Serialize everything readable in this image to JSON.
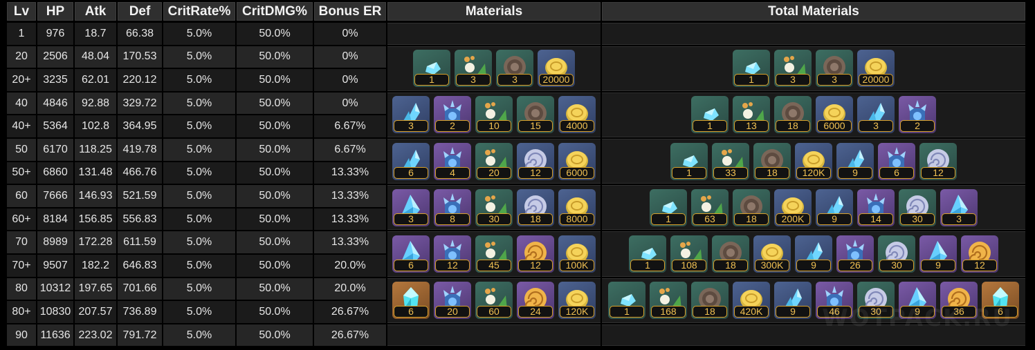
{
  "headers": {
    "lv": "Lv",
    "hp": "HP",
    "atk": "Atk",
    "def": "Def",
    "crit_rate": "CritRate%",
    "crit_dmg": "CritDMG%",
    "bonus_er": "Bonus ER",
    "materials": "Materials",
    "total_materials": "Total Materials"
  },
  "rows": [
    [
      "1",
      "976",
      "18.7",
      "66.38",
      "5.0%",
      "50.0%",
      "0%"
    ],
    [
      "20",
      "2506",
      "48.04",
      "170.53",
      "5.0%",
      "50.0%",
      "0%"
    ],
    [
      "20+",
      "3235",
      "62.01",
      "220.12",
      "5.0%",
      "50.0%",
      "0%"
    ],
    [
      "40",
      "4846",
      "92.88",
      "329.72",
      "5.0%",
      "50.0%",
      "0%"
    ],
    [
      "40+",
      "5364",
      "102.8",
      "364.95",
      "5.0%",
      "50.0%",
      "6.67%"
    ],
    [
      "50",
      "6170",
      "118.25",
      "419.78",
      "5.0%",
      "50.0%",
      "6.67%"
    ],
    [
      "50+",
      "6860",
      "131.48",
      "466.76",
      "5.0%",
      "50.0%",
      "13.33%"
    ],
    [
      "60",
      "7666",
      "146.93",
      "521.59",
      "5.0%",
      "50.0%",
      "13.33%"
    ],
    [
      "60+",
      "8184",
      "156.85",
      "556.83",
      "5.0%",
      "50.0%",
      "13.33%"
    ],
    [
      "70",
      "8989",
      "172.28",
      "611.59",
      "5.0%",
      "50.0%",
      "13.33%"
    ],
    [
      "70+",
      "9507",
      "182.2",
      "646.83",
      "5.0%",
      "50.0%",
      "20.0%"
    ],
    [
      "80",
      "10312",
      "197.65",
      "701.66",
      "5.0%",
      "50.0%",
      "20.0%"
    ],
    [
      "80+",
      "10830",
      "207.57",
      "736.89",
      "5.0%",
      "50.0%",
      "26.67%"
    ],
    [
      "90",
      "11636",
      "223.02",
      "791.72",
      "5.0%",
      "50.0%",
      "26.67%"
    ]
  ],
  "material_blocks": [
    {
      "materials": [
        {
          "icon": "gem-sliver-icon",
          "quality": "green",
          "count": "1"
        },
        {
          "icon": "local-specialty-icon",
          "quality": "green",
          "count": "3"
        },
        {
          "icon": "shell-drop-icon",
          "quality": "green",
          "count": "3"
        },
        {
          "icon": "mora-coin-icon",
          "quality": "blue",
          "count": "20000"
        }
      ],
      "totals": [
        {
          "icon": "gem-sliver-icon",
          "quality": "green",
          "count": "1"
        },
        {
          "icon": "local-specialty-icon",
          "quality": "green",
          "count": "3"
        },
        {
          "icon": "shell-drop-icon",
          "quality": "green",
          "count": "3"
        },
        {
          "icon": "mora-coin-icon",
          "quality": "blue",
          "count": "20000"
        }
      ]
    },
    {
      "materials": [
        {
          "icon": "gem-fragment-icon",
          "quality": "blue",
          "count": "3"
        },
        {
          "icon": "boss-crystal-icon",
          "quality": "purple",
          "count": "2"
        },
        {
          "icon": "local-specialty-icon",
          "quality": "green",
          "count": "10"
        },
        {
          "icon": "shell-drop-icon",
          "quality": "green",
          "count": "15"
        },
        {
          "icon": "mora-coin-icon",
          "quality": "blue",
          "count": "4000"
        }
      ],
      "totals": [
        {
          "icon": "gem-sliver-icon",
          "quality": "green",
          "count": "1"
        },
        {
          "icon": "local-specialty-icon",
          "quality": "green",
          "count": "13"
        },
        {
          "icon": "shell-drop-icon",
          "quality": "green",
          "count": "18"
        },
        {
          "icon": "mora-coin-icon",
          "quality": "blue",
          "count": "6000"
        },
        {
          "icon": "gem-fragment-icon",
          "quality": "blue",
          "count": "3"
        },
        {
          "icon": "boss-crystal-icon",
          "quality": "purple",
          "count": "2"
        }
      ]
    },
    {
      "materials": [
        {
          "icon": "gem-fragment-icon",
          "quality": "blue",
          "count": "6"
        },
        {
          "icon": "boss-crystal-icon",
          "quality": "purple",
          "count": "4"
        },
        {
          "icon": "local-specialty-icon",
          "quality": "green",
          "count": "20"
        },
        {
          "icon": "spiral-shell-icon",
          "quality": "blue",
          "count": "12"
        },
        {
          "icon": "mora-coin-icon",
          "quality": "blue",
          "count": "6000"
        }
      ],
      "totals": [
        {
          "icon": "gem-sliver-icon",
          "quality": "green",
          "count": "1"
        },
        {
          "icon": "local-specialty-icon",
          "quality": "green",
          "count": "33"
        },
        {
          "icon": "shell-drop-icon",
          "quality": "green",
          "count": "18"
        },
        {
          "icon": "mora-coin-icon",
          "quality": "blue",
          "count": "120K"
        },
        {
          "icon": "gem-fragment-icon",
          "quality": "blue",
          "count": "9"
        },
        {
          "icon": "boss-crystal-icon",
          "quality": "purple",
          "count": "6"
        },
        {
          "icon": "spiral-shell-icon",
          "quality": "green",
          "count": "12"
        }
      ]
    },
    {
      "materials": [
        {
          "icon": "gem-chunk-icon",
          "quality": "purple",
          "count": "3"
        },
        {
          "icon": "boss-crystal-icon",
          "quality": "purple",
          "count": "8"
        },
        {
          "icon": "local-specialty-icon",
          "quality": "green",
          "count": "30"
        },
        {
          "icon": "spiral-shell-icon",
          "quality": "blue",
          "count": "18"
        },
        {
          "icon": "mora-coin-icon",
          "quality": "blue",
          "count": "8000"
        }
      ],
      "totals": [
        {
          "icon": "gem-sliver-icon",
          "quality": "green",
          "count": "1"
        },
        {
          "icon": "local-specialty-icon",
          "quality": "green",
          "count": "63"
        },
        {
          "icon": "shell-drop-icon",
          "quality": "green",
          "count": "18"
        },
        {
          "icon": "mora-coin-icon",
          "quality": "blue",
          "count": "200K"
        },
        {
          "icon": "gem-fragment-icon",
          "quality": "blue",
          "count": "9"
        },
        {
          "icon": "boss-crystal-icon",
          "quality": "purple",
          "count": "14"
        },
        {
          "icon": "spiral-shell-icon",
          "quality": "green",
          "count": "30"
        },
        {
          "icon": "gem-chunk-icon",
          "quality": "purple",
          "count": "3"
        }
      ]
    },
    {
      "materials": [
        {
          "icon": "gem-chunk-icon",
          "quality": "purple",
          "count": "6"
        },
        {
          "icon": "boss-crystal-icon",
          "quality": "purple",
          "count": "12"
        },
        {
          "icon": "local-specialty-icon",
          "quality": "green",
          "count": "45"
        },
        {
          "icon": "golden-shell-icon",
          "quality": "purple",
          "count": "12"
        },
        {
          "icon": "mora-coin-icon",
          "quality": "blue",
          "count": "100K"
        }
      ],
      "totals": [
        {
          "icon": "gem-sliver-icon",
          "quality": "green",
          "count": "1"
        },
        {
          "icon": "local-specialty-icon",
          "quality": "green",
          "count": "108"
        },
        {
          "icon": "shell-drop-icon",
          "quality": "green",
          "count": "18"
        },
        {
          "icon": "mora-coin-icon",
          "quality": "blue",
          "count": "300K"
        },
        {
          "icon": "gem-fragment-icon",
          "quality": "blue",
          "count": "9"
        },
        {
          "icon": "boss-crystal-icon",
          "quality": "purple",
          "count": "26"
        },
        {
          "icon": "spiral-shell-icon",
          "quality": "green",
          "count": "30"
        },
        {
          "icon": "gem-chunk-icon",
          "quality": "purple",
          "count": "9"
        },
        {
          "icon": "golden-shell-icon",
          "quality": "purple",
          "count": "12"
        }
      ]
    },
    {
      "materials": [
        {
          "icon": "gemstone-icon",
          "quality": "orange",
          "count": "6"
        },
        {
          "icon": "boss-crystal-icon",
          "quality": "purple",
          "count": "20"
        },
        {
          "icon": "local-specialty-icon",
          "quality": "green",
          "count": "60"
        },
        {
          "icon": "golden-shell-icon",
          "quality": "purple",
          "count": "24"
        },
        {
          "icon": "mora-coin-icon",
          "quality": "blue",
          "count": "120K"
        }
      ],
      "totals": [
        {
          "icon": "gem-sliver-icon",
          "quality": "green",
          "count": "1"
        },
        {
          "icon": "local-specialty-icon",
          "quality": "green",
          "count": "168"
        },
        {
          "icon": "shell-drop-icon",
          "quality": "green",
          "count": "18"
        },
        {
          "icon": "mora-coin-icon",
          "quality": "blue",
          "count": "420K"
        },
        {
          "icon": "gem-fragment-icon",
          "quality": "blue",
          "count": "9"
        },
        {
          "icon": "boss-crystal-icon",
          "quality": "purple",
          "count": "46"
        },
        {
          "icon": "spiral-shell-icon",
          "quality": "green",
          "count": "30"
        },
        {
          "icon": "gem-chunk-icon",
          "quality": "purple",
          "count": "9"
        },
        {
          "icon": "golden-shell-icon",
          "quality": "purple",
          "count": "36"
        },
        {
          "icon": "gemstone-icon",
          "quality": "orange",
          "count": "6"
        }
      ]
    }
  ],
  "watermark": "WOTPACK.RU",
  "colors": {
    "background": "#000000",
    "header_bg": "#2f2f2f",
    "row_odd": "#1b1b1b",
    "row_even": "#262626",
    "count_text": "#f0c052",
    "count_border": "#d9a12a"
  }
}
